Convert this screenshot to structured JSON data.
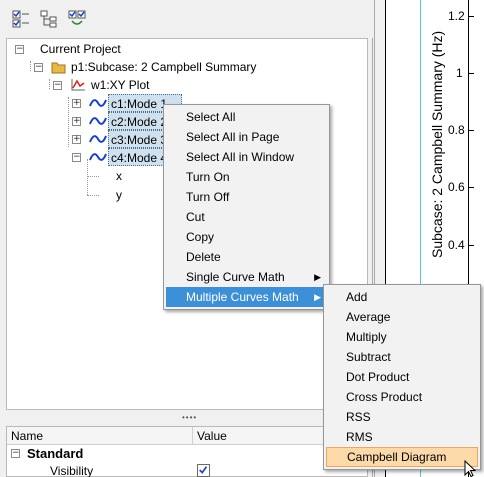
{
  "tree": {
    "root": "Current Project",
    "page": "p1:Subcase: 2 Campbell Summary",
    "window": "w1:XY Plot",
    "curves": [
      "c1:Mode 1",
      "c2:Mode 2",
      "c3:Mode 3",
      "c4:Mode 4"
    ],
    "axes": [
      "x",
      "y"
    ]
  },
  "properties": {
    "col_name": "Name",
    "col_value": "Value",
    "section": "Standard",
    "rows": [
      {
        "name": "Visibility",
        "checked": true
      }
    ]
  },
  "plot": {
    "ylabel": "Subcase: 2 Campbell Summary (Hz)",
    "yticks": [
      "1.2",
      "1",
      "0.8",
      "0.6",
      "0.4"
    ]
  },
  "context_menu": {
    "items": [
      "Select All",
      "Select All in Page",
      "Select All in Window",
      "Turn On",
      "Turn Off",
      "Cut",
      "Copy",
      "Delete",
      "Single Curve Math",
      "Multiple Curves Math"
    ],
    "highlighted": "Multiple Curves Math"
  },
  "submenu": {
    "items": [
      "Add",
      "Average",
      "Multiply",
      "Subtract",
      "Dot Product",
      "Cross Product",
      "RSS",
      "RMS",
      "Campbell Diagram"
    ],
    "highlighted": "Campbell Diagram"
  },
  "colors": {
    "menu_highlight": "#3d8fd6",
    "submenu_highlight": "#fcd9a9",
    "curve_icon": "#1a3fc2",
    "plot_line": "#4fc9d6"
  }
}
